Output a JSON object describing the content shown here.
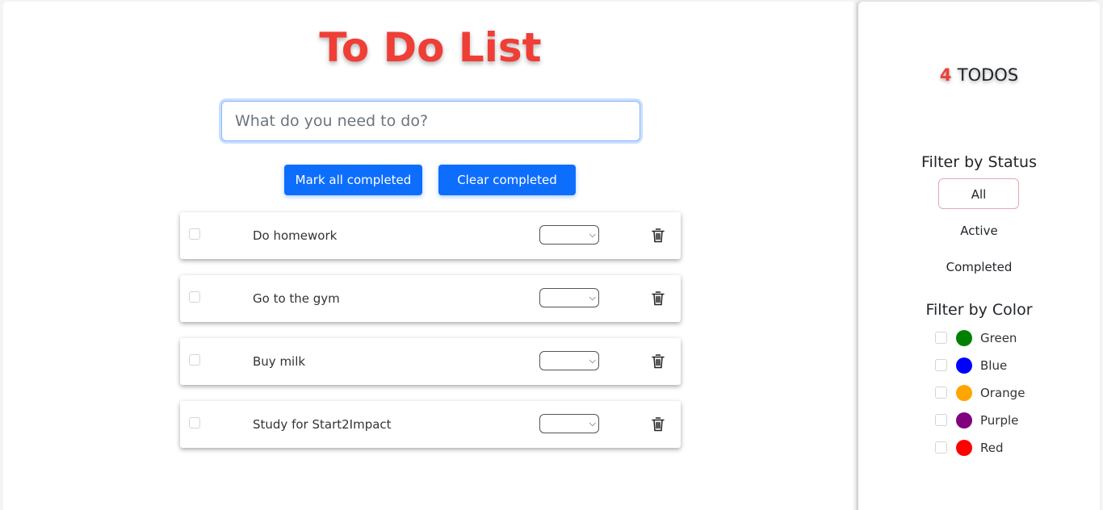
{
  "app": {
    "title": "To Do List",
    "input_placeholder": "What do you need to do?",
    "mark_all_label": "Mark all completed",
    "clear_completed_label": "Clear completed"
  },
  "todos": [
    {
      "text": "Do homework",
      "completed": false
    },
    {
      "text": "Go to the gym",
      "completed": false
    },
    {
      "text": "Buy milk",
      "completed": false
    },
    {
      "text": "Study for Start2Impact",
      "completed": false
    }
  ],
  "sidebar": {
    "count": "4",
    "count_label": "TODOS",
    "status_heading": "Filter by Status",
    "status_filters": [
      {
        "label": "All",
        "active": true
      },
      {
        "label": "Active",
        "active": false
      },
      {
        "label": "Completed",
        "active": false
      }
    ],
    "color_heading": "Filter by Color",
    "colors": [
      {
        "label": "Green",
        "hex": "#008000"
      },
      {
        "label": "Blue",
        "hex": "#0000ff"
      },
      {
        "label": "Orange",
        "hex": "#ffa500"
      },
      {
        "label": "Purple",
        "hex": "#800080"
      },
      {
        "label": "Red",
        "hex": "#ff0000"
      }
    ]
  },
  "theme": {
    "accent_red": "#ef3e36",
    "primary_blue": "#0d6efd"
  }
}
